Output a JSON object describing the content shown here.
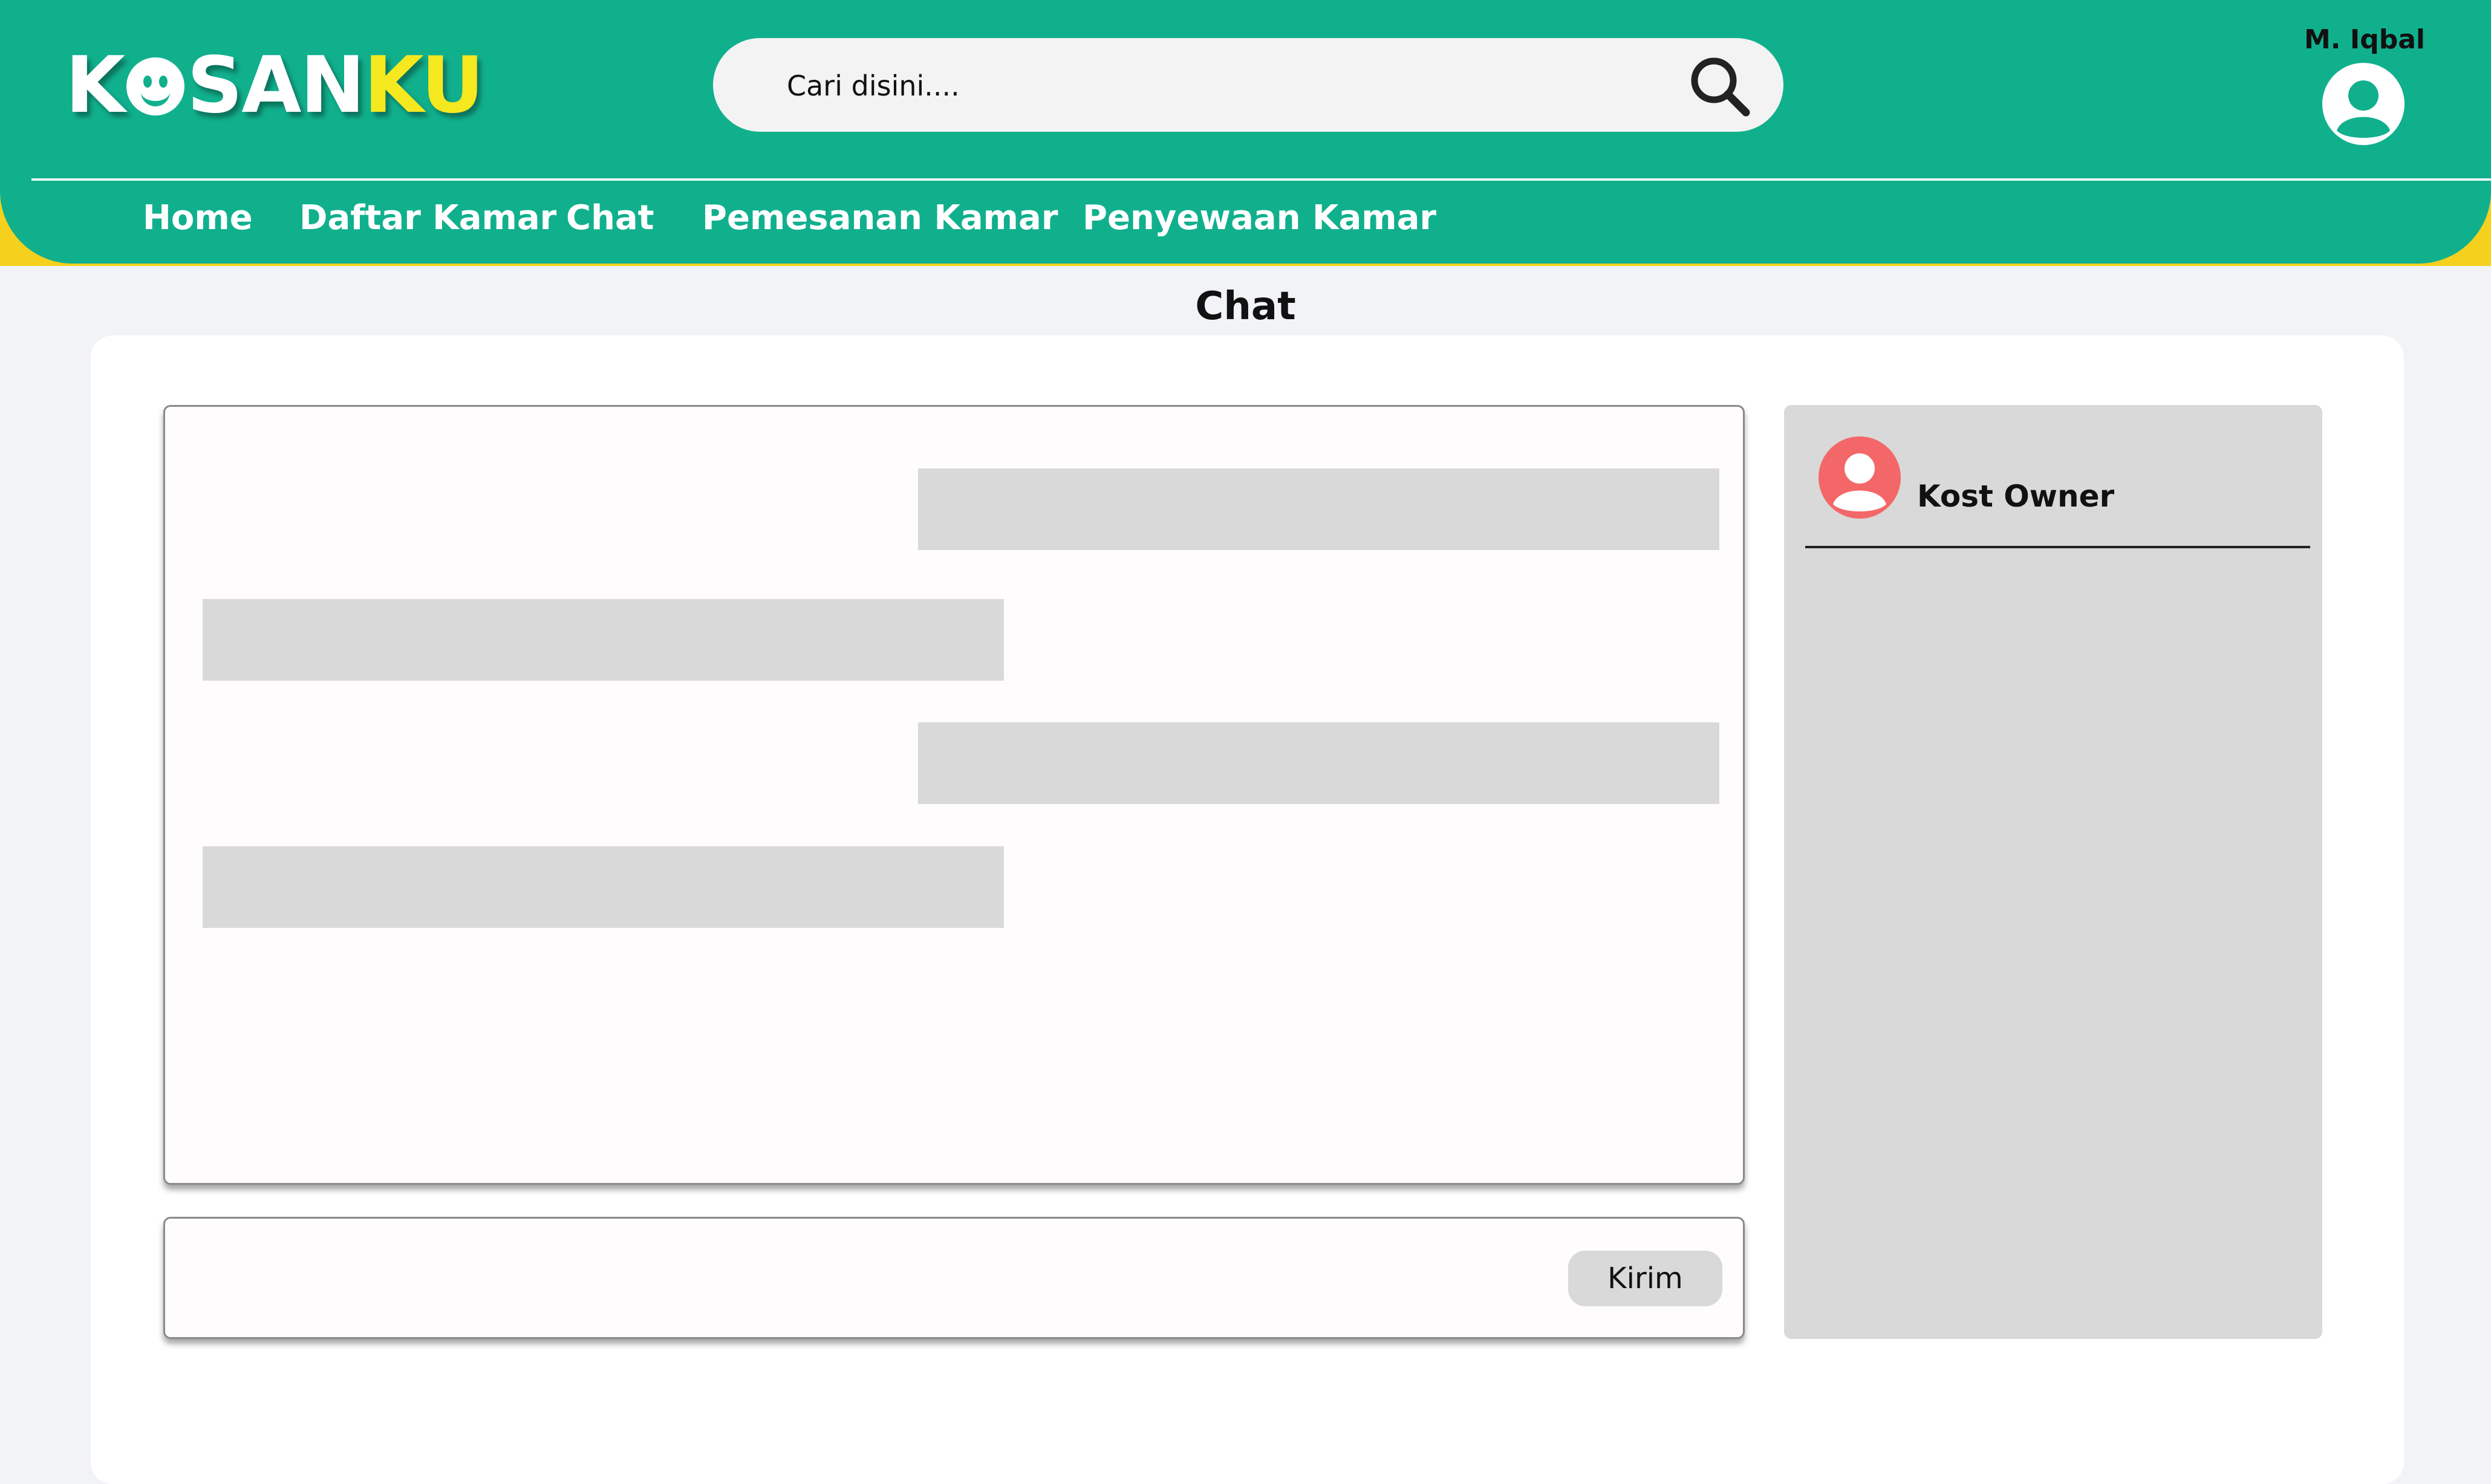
{
  "brand": {
    "logo_part1": "KOSAN",
    "logo_part2": "KU"
  },
  "search": {
    "placeholder": "Cari disini....",
    "value": ""
  },
  "user": {
    "name": "M. Iqbal"
  },
  "nav": {
    "items": [
      {
        "label": "Home"
      },
      {
        "label": "Daftar Kamar"
      },
      {
        "label": "Chat"
      },
      {
        "label": "Pemesanan Kamar"
      },
      {
        "label": "Penyewaan Kamar"
      }
    ]
  },
  "page": {
    "title": "Chat"
  },
  "composer": {
    "send_label": "Kirim",
    "value": ""
  },
  "contacts": [
    {
      "name": "Kost Owner"
    }
  ],
  "colors": {
    "primary": "#11b08d",
    "accent": "#f5d11e",
    "logo_accent": "#f6e81f",
    "contact_avatar": "#f36769",
    "placeholder_gray": "#d9d9d9"
  }
}
